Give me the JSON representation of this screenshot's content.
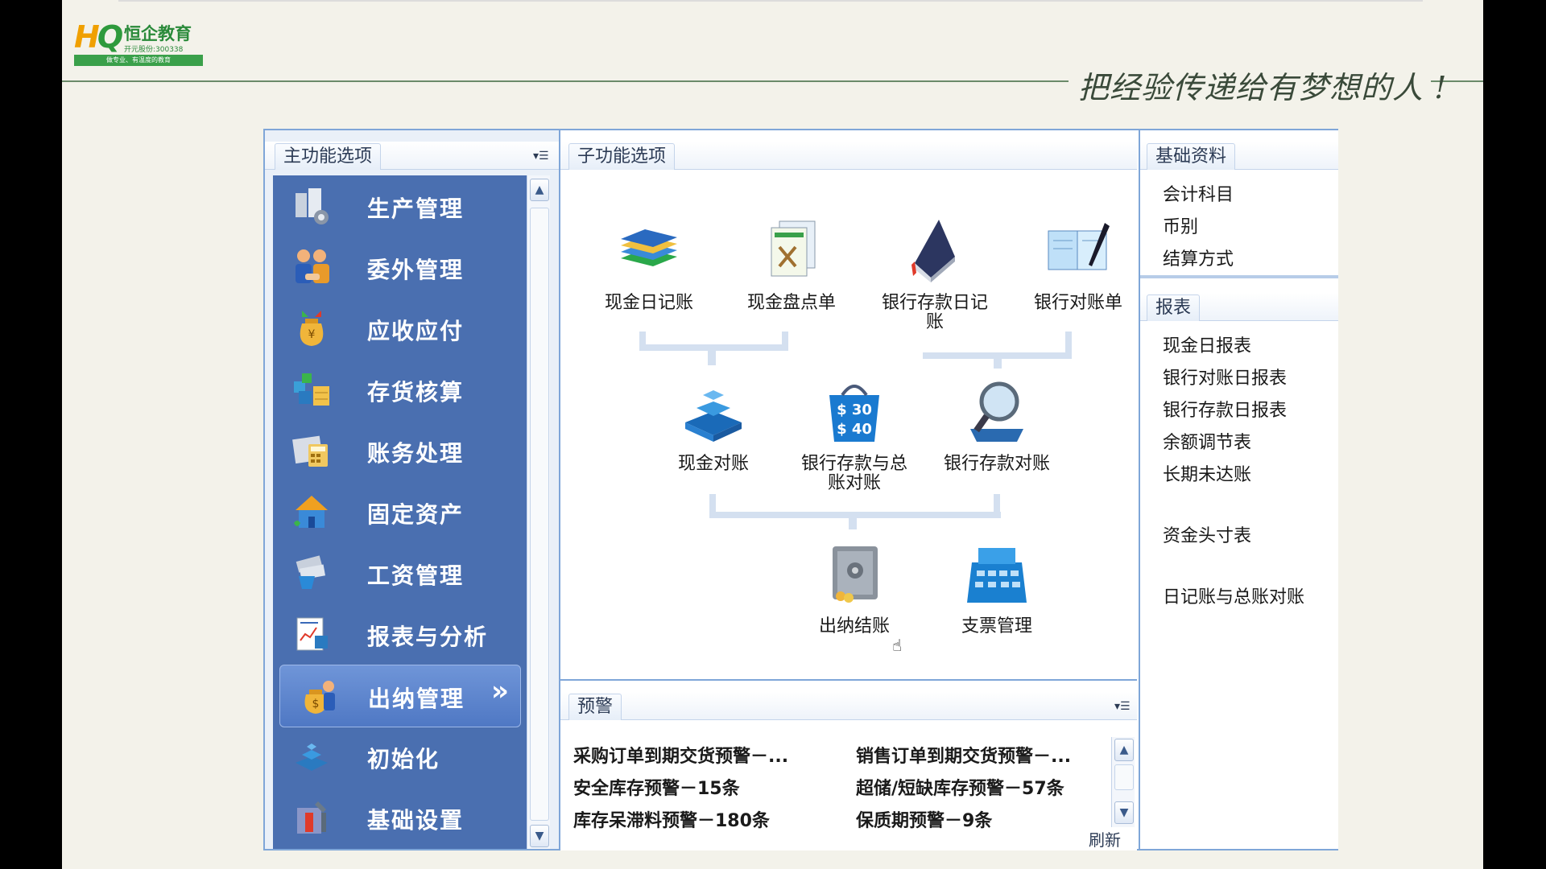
{
  "header": {
    "logo_mark_a": "H",
    "logo_mark_b": "Q",
    "logo_name": "恒企教育",
    "logo_sub": "开元股份:300338",
    "logo_tagline": "做专业、有温度的教育",
    "slogan": "把经验传递给有梦想的人 !"
  },
  "left_panel": {
    "tab": "主功能选项",
    "items": [
      {
        "label": "生产管理",
        "icon": "factory-icon"
      },
      {
        "label": "委外管理",
        "icon": "handshake-icon"
      },
      {
        "label": "应收应付",
        "icon": "money-bag-icon"
      },
      {
        "label": "存货核算",
        "icon": "boxes-icon"
      },
      {
        "label": "账务处理",
        "icon": "calculator-icon"
      },
      {
        "label": "固定资产",
        "icon": "house-icon"
      },
      {
        "label": "工资管理",
        "icon": "wage-icon"
      },
      {
        "label": "报表与分析",
        "icon": "report-icon"
      },
      {
        "label": "出纳管理",
        "icon": "cashier-icon",
        "active": true
      },
      {
        "label": "初始化",
        "icon": "blocks-icon"
      },
      {
        "label": "基础设置",
        "icon": "toolbox-icon"
      }
    ]
  },
  "middle_panel": {
    "tab": "子功能选项",
    "functions": {
      "cash_journal": "现金日记账",
      "cash_count": "现金盘点单",
      "bank_journal": "银行存款日记账",
      "bank_statement": "银行对账单",
      "cash_reconcile": "现金对账",
      "bank_ledger_reconcile": "银行存款与总账对账",
      "bank_reconcile": "银行存款对账",
      "cashier_close": "出纳结账",
      "cheque_mgmt": "支票管理"
    },
    "price_tag_1": "$ 30",
    "price_tag_2": "$ 40"
  },
  "warning_panel": {
    "tab": "预警",
    "items": [
      "采购订单到期交货预警－...",
      "销售订单到期交货预警－...",
      "安全库存预警－15条",
      "超储/短缺库存预警－57条",
      "库存呆滞料预警－180条",
      "保质期预警－9条"
    ],
    "refresh": "刷新"
  },
  "right_panel": {
    "basic_tab": "基础资料",
    "basic_items": [
      "会计科目",
      "币别",
      "结算方式"
    ],
    "report_tab": "报表",
    "report_items": [
      "现金日报表",
      "银行对账日报表",
      "银行存款日报表",
      "余额调节表",
      "长期未达账",
      "资金头寸表",
      "日记账与总账对账"
    ]
  }
}
